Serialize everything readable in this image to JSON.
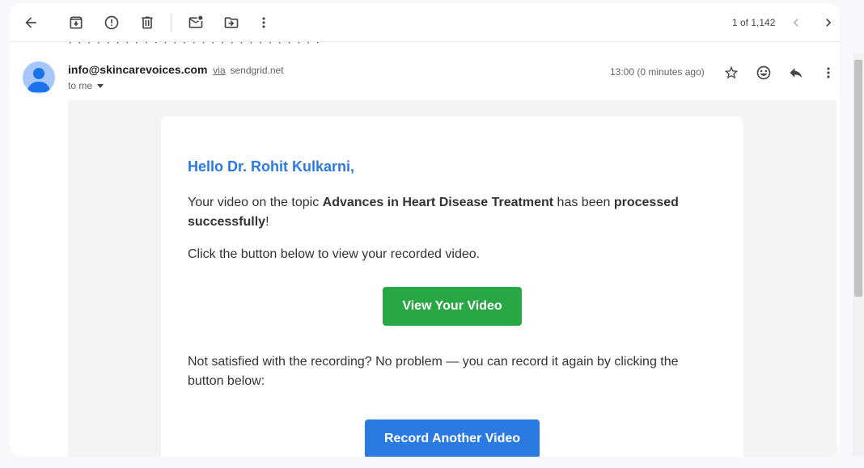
{
  "toolbar": {
    "back_icon": "arrow-back-icon",
    "archive_icon": "archive-icon",
    "report_icon": "report-spam-icon",
    "delete_icon": "delete-icon",
    "mark_unread_icon": "mark-unread-icon",
    "move_icon": "move-to-icon",
    "more_icon": "more-vert-icon",
    "pagination": "1 of 1,142",
    "older_icon": "chevron-left-icon",
    "newer_icon": "chevron-right-icon"
  },
  "email": {
    "subject_partial": "· · · · · · · · · · · · · · · · · · · · · · · · · · ·",
    "sender": "info@skincarevoices.com",
    "via_label": "via",
    "via_domain": "sendgrid.net",
    "to_label": "to me",
    "timestamp": "13:00 (0 minutes ago)"
  },
  "body": {
    "greeting": "Hello Dr. Rohit Kulkarni,",
    "p1_prefix": "Your video on the topic ",
    "p1_topic": "Advances in Heart Disease Treatment",
    "p1_middle": " has been ",
    "p1_status": "processed successfully",
    "p1_suffix": "!",
    "p2": "Click the button below to view your recorded video.",
    "view_button": "View Your Video",
    "p3": "Not satisfied with the recording? No problem — you can record it again by clicking the button below:",
    "record_button": "Record Another Video"
  },
  "colors": {
    "accent_blue": "#2a7ae2",
    "accent_green": "#28a745"
  }
}
